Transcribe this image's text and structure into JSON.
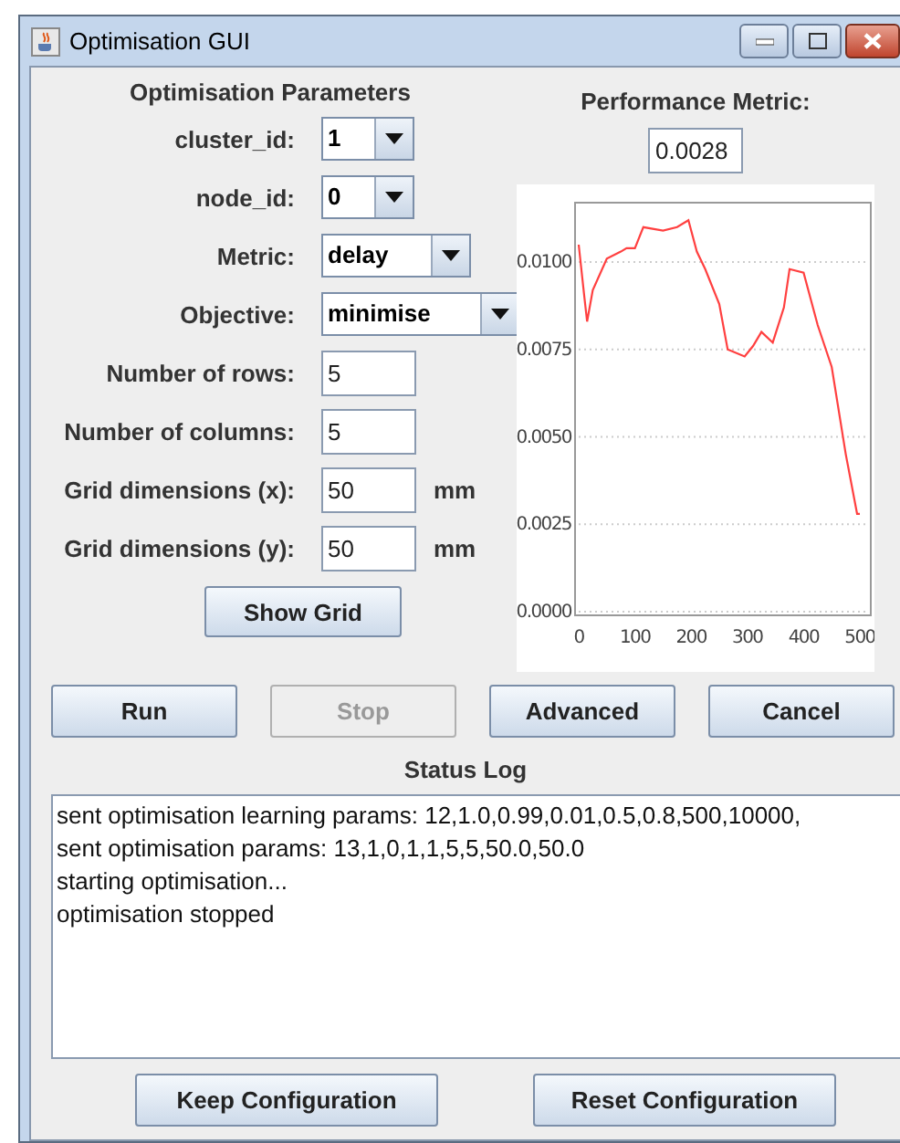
{
  "window": {
    "title": "Optimisation GUI"
  },
  "parameters": {
    "heading": "Optimisation Parameters",
    "fields": [
      {
        "kind": "combo",
        "label": "cluster_id:",
        "value": "1"
      },
      {
        "kind": "combo",
        "label": "node_id:",
        "value": "0"
      },
      {
        "kind": "combo",
        "label": "Metric:",
        "value": "delay"
      },
      {
        "kind": "combo",
        "label": "Objective:",
        "value": "minimise"
      },
      {
        "kind": "text",
        "label": "Number of rows:",
        "value": "5"
      },
      {
        "kind": "text",
        "label": "Number of columns:",
        "value": "5"
      },
      {
        "kind": "text",
        "label": "Grid dimensions (x):",
        "value": "50",
        "unit": "mm"
      },
      {
        "kind": "text",
        "label": "Grid dimensions (y):",
        "value": "50",
        "unit": "mm"
      }
    ],
    "show_grid": "Show Grid"
  },
  "performance": {
    "label": "Performance Metric:",
    "value": "0.0028",
    "chart_data": {
      "type": "line",
      "x": [
        0,
        10,
        15,
        25,
        50,
        75,
        85,
        100,
        115,
        150,
        175,
        195,
        210,
        225,
        250,
        265,
        295,
        310,
        325,
        345,
        365,
        375,
        400,
        425,
        450,
        475,
        495,
        500
      ],
      "series": [
        {
          "color": "#ff4040",
          "values": [
            0.0105,
            0.009,
            0.0083,
            0.0092,
            0.0101,
            0.0103,
            0.0104,
            0.0104,
            0.011,
            0.0109,
            0.011,
            0.0112,
            0.0103,
            0.0098,
            0.0088,
            0.0075,
            0.0073,
            0.0076,
            0.008,
            0.0077,
            0.0087,
            0.0098,
            0.0097,
            0.0082,
            0.007,
            0.0045,
            0.0028,
            0.0028
          ]
        }
      ],
      "grid": true,
      "xlim": [
        0,
        500
      ],
      "ylim": [
        0,
        0.0117
      ],
      "xticks": [
        0,
        100,
        200,
        300,
        400,
        500
      ],
      "yticks": [
        {
          "value": 0,
          "label": "0.0000"
        },
        {
          "value": 0.0025,
          "label": "0.0025"
        },
        {
          "value": 0.005,
          "label": "0.0050"
        },
        {
          "value": 0.0075,
          "label": "0.0075"
        },
        {
          "value": 0.01,
          "label": "0.0100"
        }
      ]
    }
  },
  "actions": [
    {
      "label": "Run",
      "disabled": false
    },
    {
      "label": "Stop",
      "disabled": true
    },
    {
      "label": "Advanced",
      "disabled": false
    },
    {
      "label": "Cancel",
      "disabled": false
    }
  ],
  "status_log": {
    "heading": "Status Log",
    "lines": [
      "sent optimisation learning params: 12,1.0,0.99,0.01,0.5,0.8,500,10000,",
      "sent optimisation params: 13,1,0,1,1,5,5,50.0,50.0",
      "starting optimisation...",
      "optimisation stopped"
    ]
  },
  "config_buttons": [
    "Keep Configuration",
    "Reset Configuration"
  ]
}
